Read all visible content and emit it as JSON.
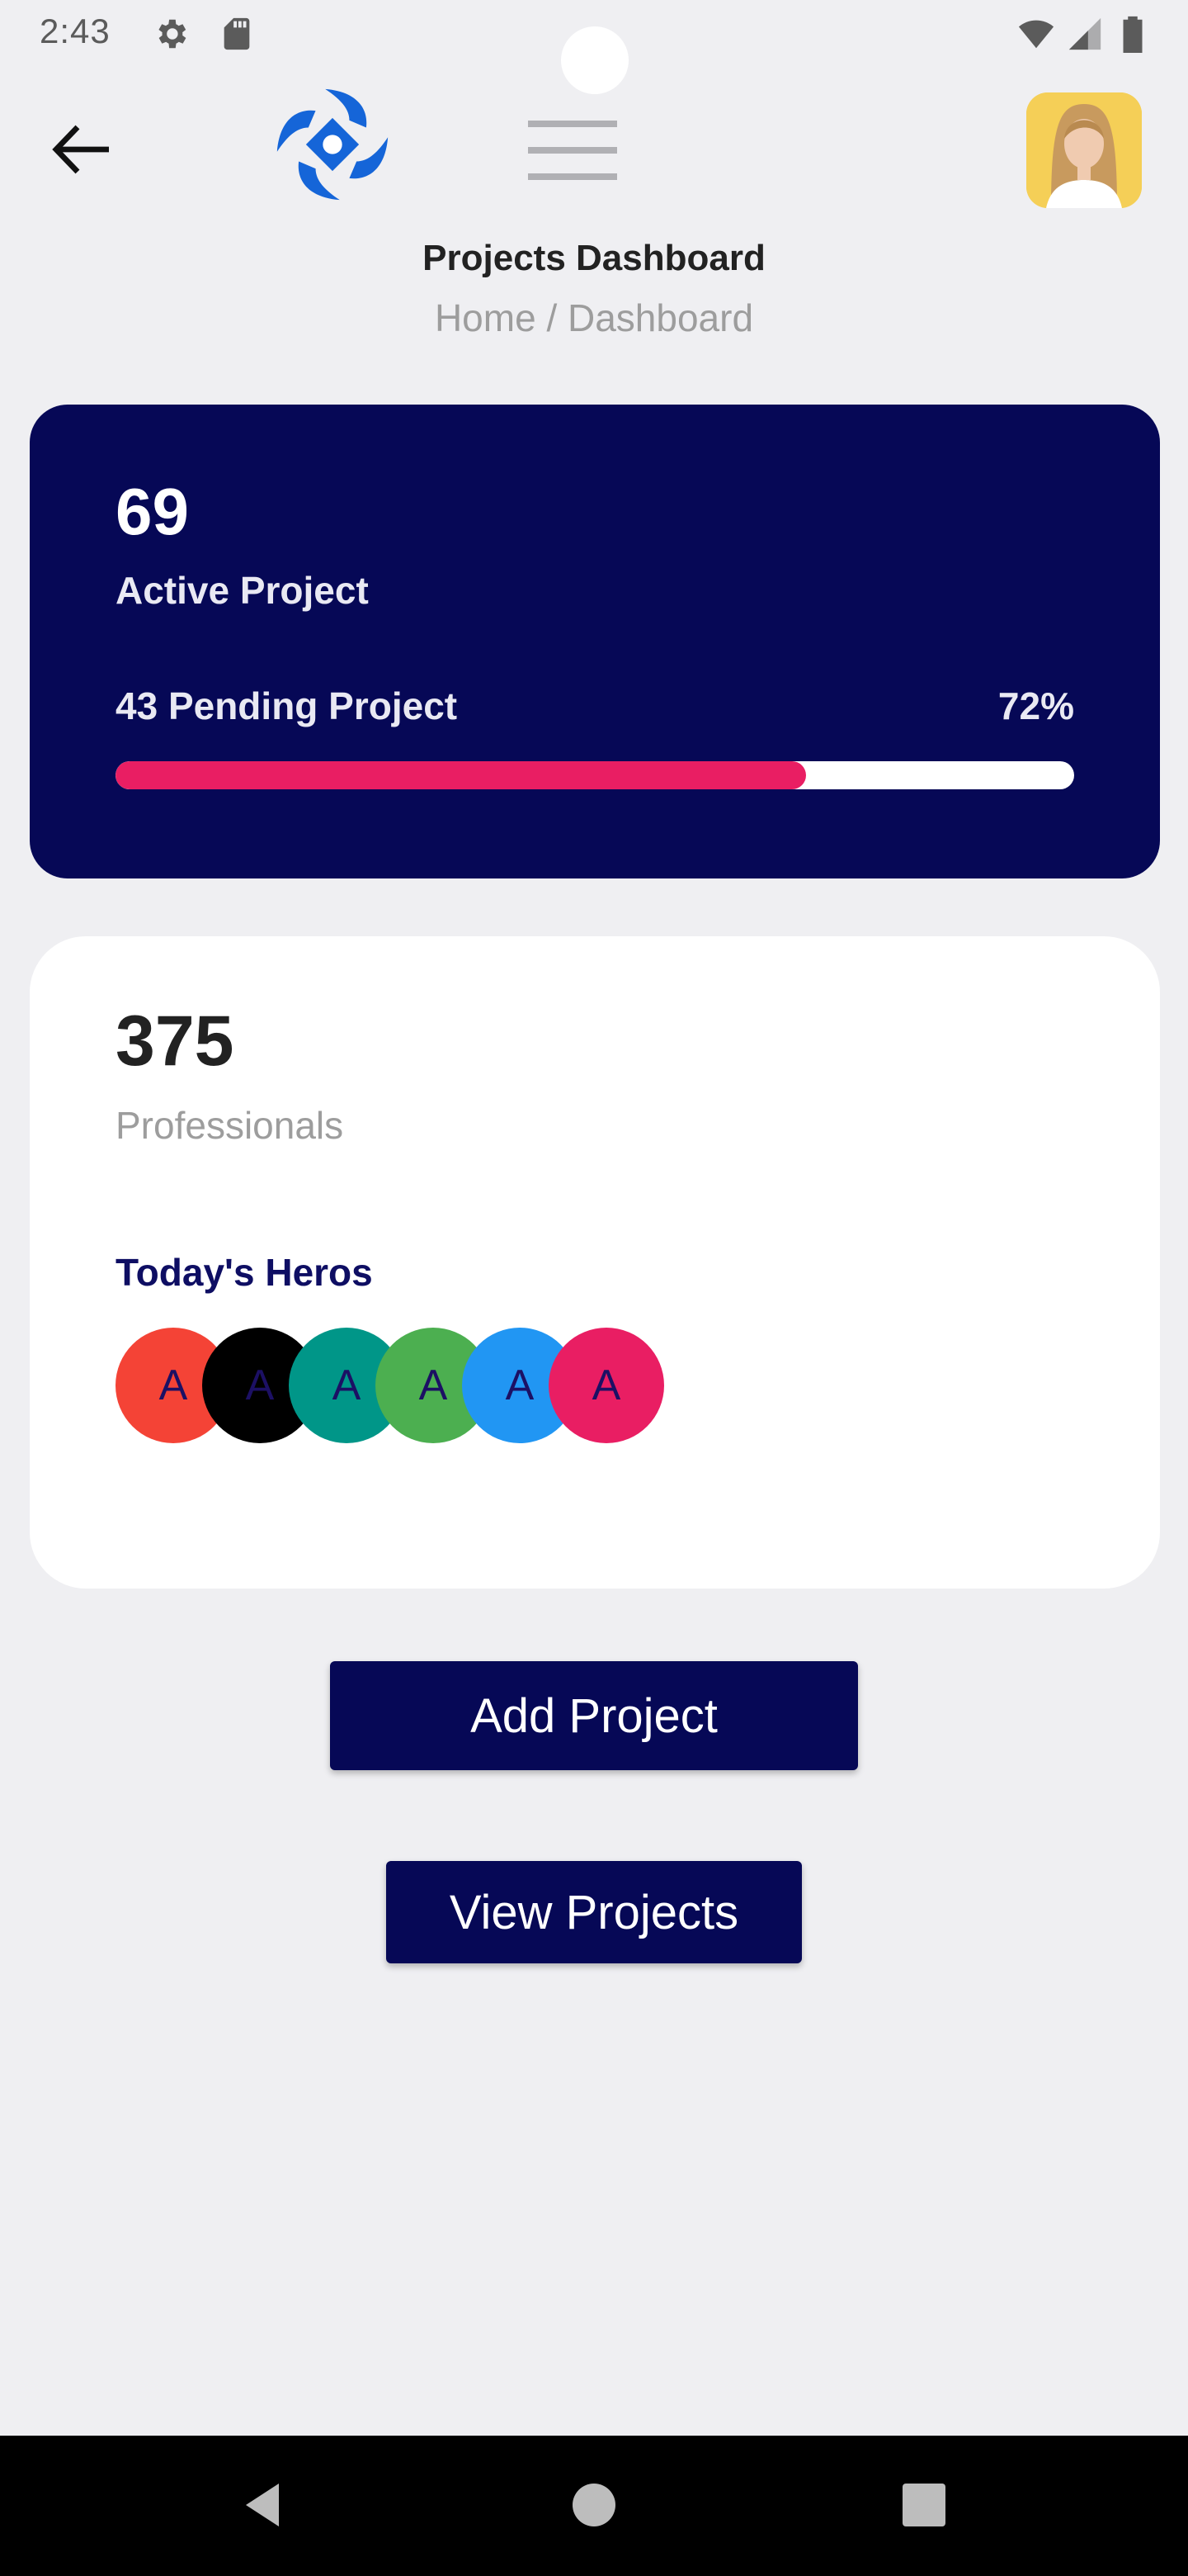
{
  "status_bar": {
    "time": "2:43"
  },
  "header": {
    "title": "Projects Dashboard",
    "breadcrumb": "Home / Dashboard"
  },
  "active_card": {
    "count": "69",
    "label": "Active Project",
    "pending_label": "43 Pending Project",
    "percent_label": "72%",
    "progress_fraction": 0.72,
    "colors": {
      "background": "#060856",
      "bar_fill": "#e91e63",
      "bar_track": "#ffffff"
    }
  },
  "professionals_card": {
    "count": "375",
    "label": "Professionals",
    "heroes_title": "Today's Heros",
    "heroes": [
      {
        "initial": "A",
        "color": "#f44336"
      },
      {
        "initial": "A",
        "color": "#000000"
      },
      {
        "initial": "A",
        "color": "#009688"
      },
      {
        "initial": "A",
        "color": "#4caf50"
      },
      {
        "initial": "A",
        "color": "#2196f3"
      },
      {
        "initial": "A",
        "color": "#e91e63"
      }
    ]
  },
  "actions": {
    "add_label": "Add Project",
    "view_label": "View Projects"
  },
  "icons": {
    "back": "arrow-back-icon",
    "logo": "app-logo-icon",
    "menu": "hamburger-menu-icon",
    "settings": "gear-icon",
    "sd_card": "sd-card-icon",
    "wifi": "wifi-icon",
    "signal": "signal-icon",
    "battery": "battery-icon"
  }
}
